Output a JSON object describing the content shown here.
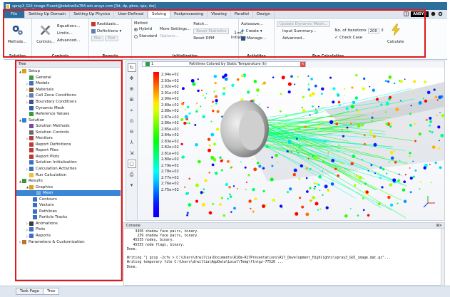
{
  "titlebar": {
    "title": "spray3_GUI_image Fluent@tebdrwilla784.win.ansys.com [3d, dp, pbns, spe, rke]"
  },
  "ribbon": {
    "tabs": [
      "File",
      "Setting Up Domain",
      "Setting Up Physics",
      "User-Defined",
      "Solving",
      "Postprocessing",
      "Viewing",
      "Parallel",
      "Design"
    ],
    "active_tab": "Solving",
    "logo": "ANSYS",
    "groups": {
      "solution": {
        "label": "Solution",
        "methods": "Methods...",
        "controls": "Controls..."
      },
      "controls": {
        "label": "Controls",
        "equations": "Equations...",
        "limits": "Limits...",
        "advanced": "Advanced..."
      },
      "reports": {
        "label": "Reports",
        "residuals": "Residuals...",
        "definitions": "Definitions",
        "file": "File",
        "plot": "Plot"
      },
      "initialization": {
        "label": "Initialization",
        "method_label": "Method",
        "hybrid": "Hybrid",
        "standard": "Standard",
        "more_settings": "More Settings...",
        "options": "Options...",
        "patch": "Patch...",
        "reset_statistics": "Reset Statistics",
        "reset_dpm": "Reset DPM",
        "initialize": "Initialize",
        "counter": "1=0"
      },
      "activities": {
        "label": "Activities",
        "autosave": "Autosave...",
        "create": "Create",
        "manage": "Manage..."
      },
      "run_calculation": {
        "label": "Run Calculation",
        "update_mesh": "Update Dynamic Mesh...",
        "input_summary": "Input Summary...",
        "advanced": "Advanced...",
        "iterations_label": "No. of Iterations",
        "iterations_value": "200",
        "check_case": "Check Case",
        "calculate": "Calculate"
      }
    }
  },
  "tree": {
    "header": "Tree",
    "nodes": [
      {
        "label": "Setup",
        "icon": "setup-icon",
        "color": "#d8a316",
        "arrow": "▲"
      },
      {
        "label": "General",
        "icon": "general-icon",
        "color": "#3a9a3a",
        "arrow": ""
      },
      {
        "label": "Models",
        "icon": "models-icon",
        "color": "#3a6fc4",
        "arrow": "▷"
      },
      {
        "label": "Materials",
        "icon": "materials-icon",
        "color": "#8a5b2a",
        "arrow": "▷"
      },
      {
        "label": "Cell Zone Conditions",
        "icon": "cell-zone-icon",
        "color": "#5a7fb0",
        "arrow": "▷"
      },
      {
        "label": "Boundary Conditions",
        "icon": "boundary-icon",
        "color": "#4a4a8a",
        "arrow": "▷"
      },
      {
        "label": "Dynamic Mesh",
        "icon": "dynamic-mesh-icon",
        "color": "#2a5fb0",
        "arrow": ""
      },
      {
        "label": "Reference Values",
        "icon": "reference-values-icon",
        "color": "#3a9a3a",
        "arrow": ""
      },
      {
        "label": "Solution",
        "icon": "solution-icon",
        "color": "#2a7fd0",
        "arrow": "▲"
      },
      {
        "label": "Solution Methods",
        "icon": "solution-methods-icon",
        "color": "#7a4aa0",
        "arrow": ""
      },
      {
        "label": "Solution Controls",
        "icon": "solution-controls-icon",
        "color": "#6a6a6a",
        "arrow": ""
      },
      {
        "label": "Monitors",
        "icon": "monitors-icon",
        "color": "#b83a3a",
        "arrow": "▷"
      },
      {
        "label": "Report Definitions",
        "icon": "report-definitions-icon",
        "color": "#b83a3a",
        "arrow": ""
      },
      {
        "label": "Report Files",
        "icon": "report-files-icon",
        "color": "#b83a3a",
        "arrow": ""
      },
      {
        "label": "Report Plots",
        "icon": "report-plots-icon",
        "color": "#b83a3a",
        "arrow": ""
      },
      {
        "label": "Solution Initialization",
        "icon": "initialization-icon",
        "color": "#3a6fc4",
        "arrow": ""
      },
      {
        "label": "Calculation Activities",
        "icon": "calculation-activities-icon",
        "color": "#3a6fc4",
        "arrow": "▷"
      },
      {
        "label": "Run Calculation",
        "icon": "run-calculation-icon",
        "color": "#e8c23a",
        "arrow": ""
      },
      {
        "label": "Results",
        "icon": "results-icon",
        "color": "#3a9a3a",
        "arrow": "▲"
      },
      {
        "label": "Graphics",
        "icon": "graphics-icon",
        "color": "#d8a316",
        "arrow": "▲"
      },
      {
        "label": "Mesh",
        "icon": "mesh-icon",
        "color": "#7fb0e0",
        "arrow": ""
      },
      {
        "label": "Contours",
        "icon": "contours-icon",
        "color": "#3a6fc4",
        "arrow": ""
      },
      {
        "label": "Vectors",
        "icon": "vectors-icon",
        "color": "#3a6fc4",
        "arrow": ""
      },
      {
        "label": "Pathlines",
        "icon": "pathlines-icon",
        "color": "#3a6fc4",
        "arrow": ""
      },
      {
        "label": "Particle Tracks",
        "icon": "particle-tracks-icon",
        "color": "#3a6fc4",
        "arrow": ""
      },
      {
        "label": "Animations",
        "icon": "animations-icon",
        "color": "#3a3a3a",
        "arrow": "▷"
      },
      {
        "label": "Plots",
        "icon": "plots-icon",
        "color": "#3a6fc4",
        "arrow": "▷"
      },
      {
        "label": "Reports",
        "icon": "reports-icon",
        "color": "#3a6fc4",
        "arrow": "▷"
      },
      {
        "label": "Parameters & Customization",
        "icon": "parameters-icon",
        "color": "#b8762a",
        "arrow": "▷"
      }
    ],
    "selected_index": 20
  },
  "graphics": {
    "tab_number": "1",
    "title": "Pathlines Colored by Static Temperature (k)",
    "legend": [
      "2.94e+02",
      "2.93e+02",
      "2.92e+02",
      "2.91e+02",
      "2.90e+02",
      "2.89e+02",
      "2.88e+02",
      "2.87e+02",
      "2.86e+02",
      "2.85e+02",
      "2.84e+02",
      "2.83e+02",
      "2.82e+02",
      "2.81e+02",
      "2.80e+02",
      "2.79e+02",
      "2.78e+02",
      "2.77e+02",
      "2.76e+02",
      "2.75e+02"
    ],
    "legend_colors": [
      "#ff0000",
      "#ff3a00",
      "#ff7400",
      "#ffae00",
      "#ffe800",
      "#dcff00",
      "#a3ff00",
      "#6aff00",
      "#30ff00",
      "#00ff0c",
      "#00ff46",
      "#00ff80",
      "#00ffb9",
      "#00fff3",
      "#00d3ff",
      "#0099ff",
      "#005fff",
      "#0026ff",
      "#1400ff",
      "#0000ff"
    ]
  },
  "console": {
    "header": "Console",
    "lines": [
      "    3456 shadow face pairs, binary.",
      "     239 shadow face pairs, binary.",
      "   45555 nodes, binary.",
      "   45555 node flags, binary.",
      "Done.",
      "",
      "Writing \"| gzip -2cfv > C:\\Users\\drwillia\\Documents\\R16m-R17Presentations\\R17_Development_Highlights\\spray3_GUI_image.dat.gz\"...",
      "Writing temporary file C:\\Users\\drwillia\\AppData\\Local\\Temp\\flntgz-77520 ...",
      "Done."
    ]
  },
  "bottom_tabs": [
    "Task Page",
    "Tree"
  ]
}
